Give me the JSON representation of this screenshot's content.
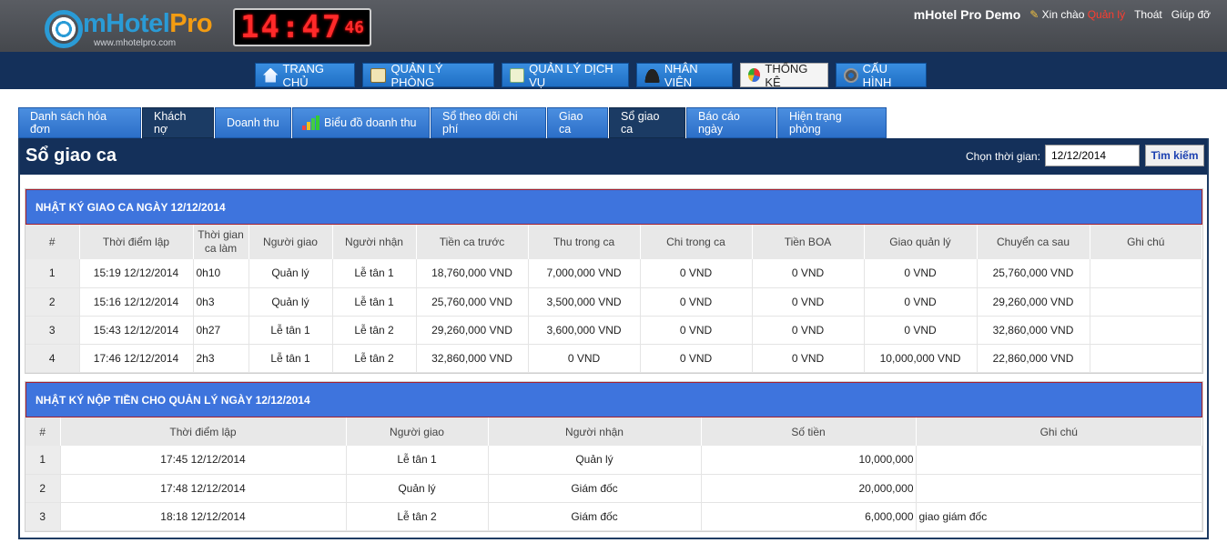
{
  "header": {
    "logo_main": "mHotel",
    "logo_accent": "Pro",
    "logo_url": "www.mhotelpro.com",
    "clock": "14:47",
    "clock_suffix": "46",
    "brand": "mHotel Pro Demo",
    "greeting": "Xin chào",
    "username": "Quản lý",
    "logout": "Thoát",
    "help": "Giúp đỡ"
  },
  "nav": [
    {
      "label": "TRANG CHỦ",
      "icon": "home-icon",
      "color": "#d6e8ff"
    },
    {
      "label": "QUẢN LÝ PHÒNG",
      "icon": "book-icon",
      "color": "#e8d8a0"
    },
    {
      "label": "QUẢN LÝ DỊCH VỤ",
      "icon": "receipt-icon",
      "color": "#e8e8c0"
    },
    {
      "label": "NHÂN VIÊN",
      "icon": "person-icon",
      "color": "#333333"
    },
    {
      "label": "THỐNG KÊ",
      "icon": "pie-chart-icon",
      "color": "#e33"
    },
    {
      "label": "CẤU HÌNH",
      "icon": "gear-icon",
      "color": "#555555"
    }
  ],
  "tabs": [
    {
      "label": "Danh sách hóa đơn"
    },
    {
      "label": "Khách nợ"
    },
    {
      "label": "Doanh thu"
    },
    {
      "label": "Biểu đồ doanh thu"
    },
    {
      "label": "Sổ theo dõi chi phí"
    },
    {
      "label": "Giao ca"
    },
    {
      "label": "Sổ giao ca"
    },
    {
      "label": "Báo cáo ngày"
    },
    {
      "label": "Hiện trạng phòng"
    }
  ],
  "panel": {
    "title": "Sổ giao ca",
    "search_label": "Chọn thời gian:",
    "search_value": "12/12/2014",
    "search_button": "Tìm kiếm"
  },
  "shift_log": {
    "title": "NHẬT KÝ GIAO CA NGÀY 12/12/2014",
    "headers": [
      "#",
      "Thời điểm lập",
      "Thời gian ca làm",
      "Người giao",
      "Người nhận",
      "Tiền ca trước",
      "Thu trong ca",
      "Chi trong ca",
      "Tiền BOA",
      "Giao quản lý",
      "Chuyển ca sau",
      "Ghi chú"
    ],
    "rows": [
      [
        "1",
        "15:19 12/12/2014",
        "0h10",
        "Quản lý",
        "Lễ tân 1",
        "18,760,000 VND",
        "7,000,000 VND",
        "0 VND",
        "0 VND",
        "0 VND",
        "25,760,000 VND",
        ""
      ],
      [
        "2",
        "15:16 12/12/2014",
        "0h3",
        "Quản lý",
        "Lễ tân 1",
        "25,760,000 VND",
        "3,500,000 VND",
        "0 VND",
        "0 VND",
        "0 VND",
        "29,260,000 VND",
        ""
      ],
      [
        "3",
        "15:43 12/12/2014",
        "0h27",
        "Lễ tân 1",
        "Lễ tân 2",
        "29,260,000 VND",
        "3,600,000 VND",
        "0 VND",
        "0 VND",
        "0 VND",
        "32,860,000 VND",
        ""
      ],
      [
        "4",
        "17:46 12/12/2014",
        "2h3",
        "Lễ tân 1",
        "Lễ tân 2",
        "32,860,000 VND",
        "0 VND",
        "0 VND",
        "0 VND",
        "10,000,000 VND",
        "22,860,000 VND",
        ""
      ]
    ]
  },
  "payment_log": {
    "title": "NHẬT KÝ NỘP TIỀN CHO QUẢN LÝ NGÀY 12/12/2014",
    "headers": [
      "#",
      "Thời điểm lập",
      "Người giao",
      "Người nhận",
      "Số tiền",
      "Ghi chú"
    ],
    "rows": [
      [
        "1",
        "17:45 12/12/2014",
        "Lễ tân 1",
        "Quản lý",
        "10,000,000",
        ""
      ],
      [
        "2",
        "17:48 12/12/2014",
        "Quản lý",
        "Giám đốc",
        "20,000,000",
        ""
      ],
      [
        "3",
        "18:18 12/12/2014",
        "Lễ tân 2",
        "Giám đốc",
        "6,000,000",
        "giao giám đốc"
      ]
    ]
  }
}
